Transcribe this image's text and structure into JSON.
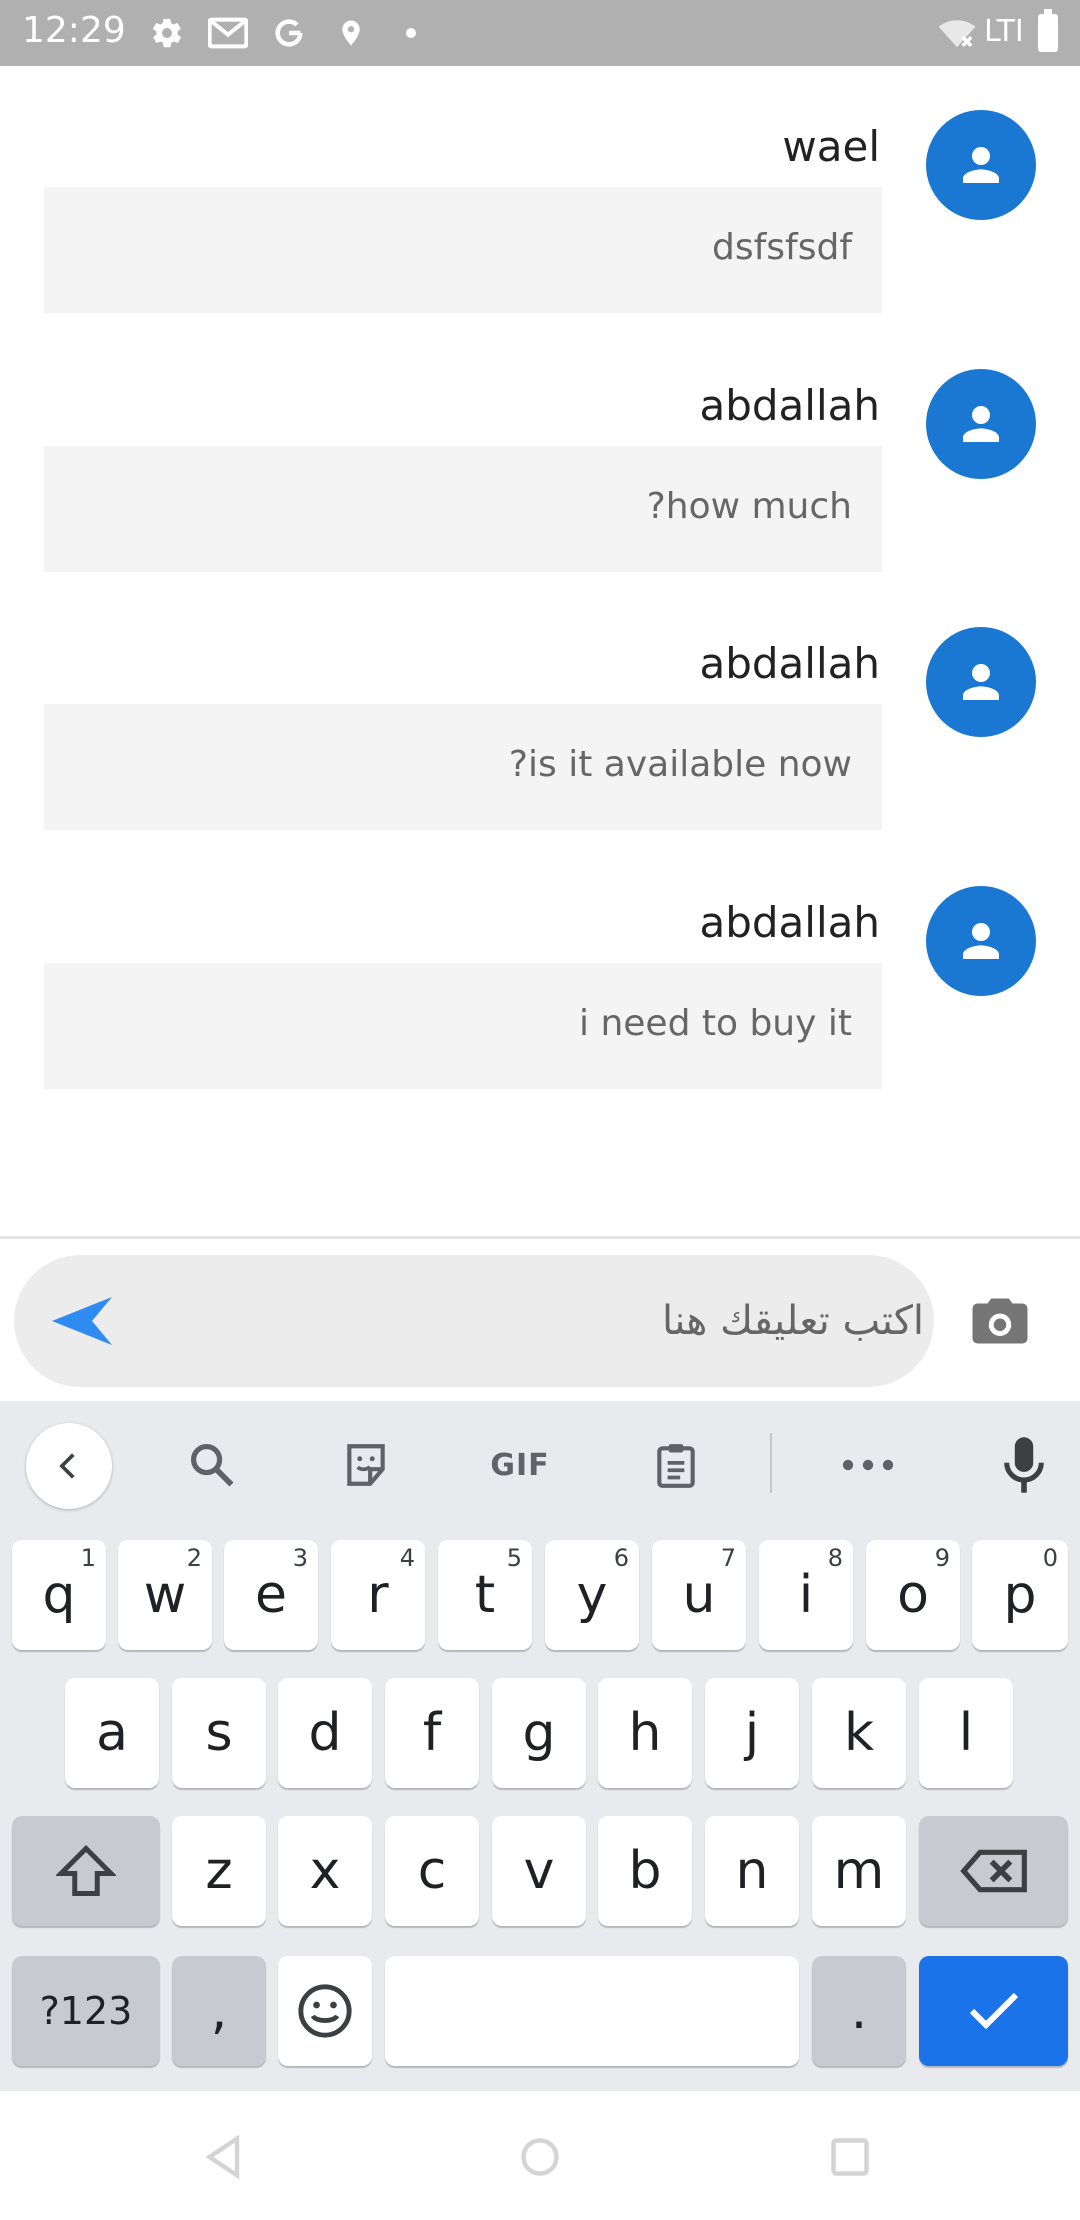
{
  "status_bar": {
    "time": "12:29",
    "network": "LTI",
    "icons": [
      "settings-icon",
      "gmail-icon",
      "google-icon",
      "location-icon",
      "dot-icon",
      "wifi-off-icon",
      "battery-icon"
    ]
  },
  "messages": [
    {
      "author": "wael",
      "text": "dsfsfsdf"
    },
    {
      "author": "abdallah",
      "text": "?how much"
    },
    {
      "author": "abdallah",
      "text": "?is it available now"
    },
    {
      "author": "abdallah",
      "text": "i need to buy it"
    }
  ],
  "composer": {
    "placeholder": "اكتب تعليقك هنا",
    "send_icon": "send-icon",
    "camera_icon": "camera-icon"
  },
  "keyboard": {
    "toolbar": {
      "gif_label": "GIF",
      "icons": [
        "back-icon",
        "search-icon",
        "sticker-icon",
        "gif-icon",
        "clipboard-icon",
        "more-icon",
        "mic-icon"
      ]
    },
    "row1": [
      {
        "key": "q",
        "num": "1"
      },
      {
        "key": "w",
        "num": "2"
      },
      {
        "key": "e",
        "num": "3"
      },
      {
        "key": "r",
        "num": "4"
      },
      {
        "key": "t",
        "num": "5"
      },
      {
        "key": "y",
        "num": "6"
      },
      {
        "key": "u",
        "num": "7"
      },
      {
        "key": "i",
        "num": "8"
      },
      {
        "key": "o",
        "num": "9"
      },
      {
        "key": "p",
        "num": "0"
      }
    ],
    "row2": [
      "a",
      "s",
      "d",
      "f",
      "g",
      "h",
      "j",
      "k",
      "l"
    ],
    "row3": [
      "z",
      "x",
      "c",
      "v",
      "b",
      "n",
      "m"
    ],
    "row4": {
      "symbols_label": "?123",
      "comma_label": ",",
      "period_label": "."
    }
  },
  "colors": {
    "accent": "#1a78d2",
    "enter_key": "#1a73e8",
    "status_bar": "#b0b0b0",
    "bubble": "#f4f4f4"
  }
}
